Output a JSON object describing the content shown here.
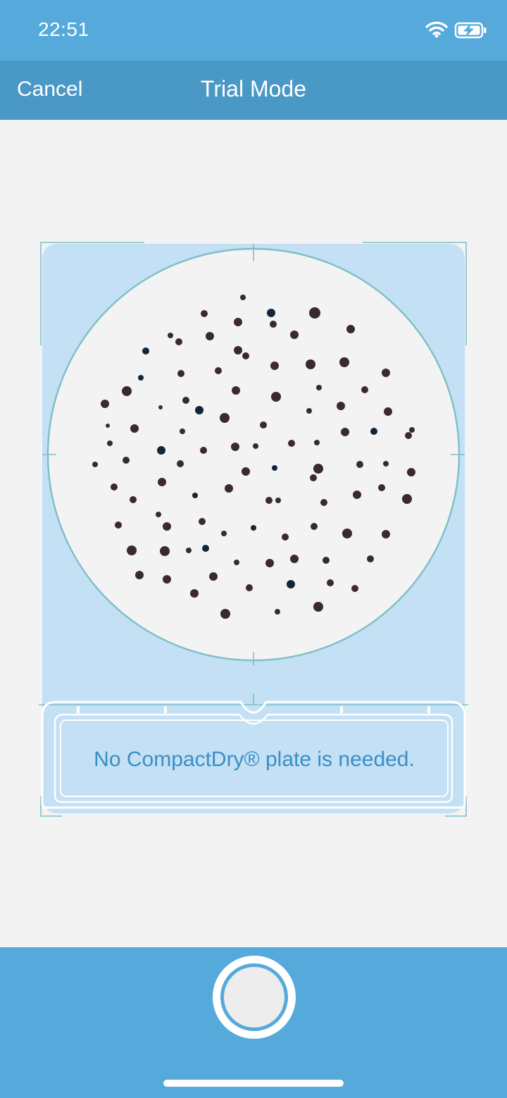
{
  "status": {
    "time": "22:51"
  },
  "nav": {
    "cancel_label": "Cancel",
    "title": "Trial Mode"
  },
  "plate": {
    "message": "No CompactDry® plate is needed."
  },
  "icons": {
    "wifi": "wifi-icon",
    "battery": "battery-charging-icon",
    "shutter": "shutter-button"
  },
  "colors": {
    "status_bar": "#55aadb",
    "nav_bar": "#4a98c6",
    "overlay": "#c3e0f4",
    "guide": "#7fbfc7"
  }
}
